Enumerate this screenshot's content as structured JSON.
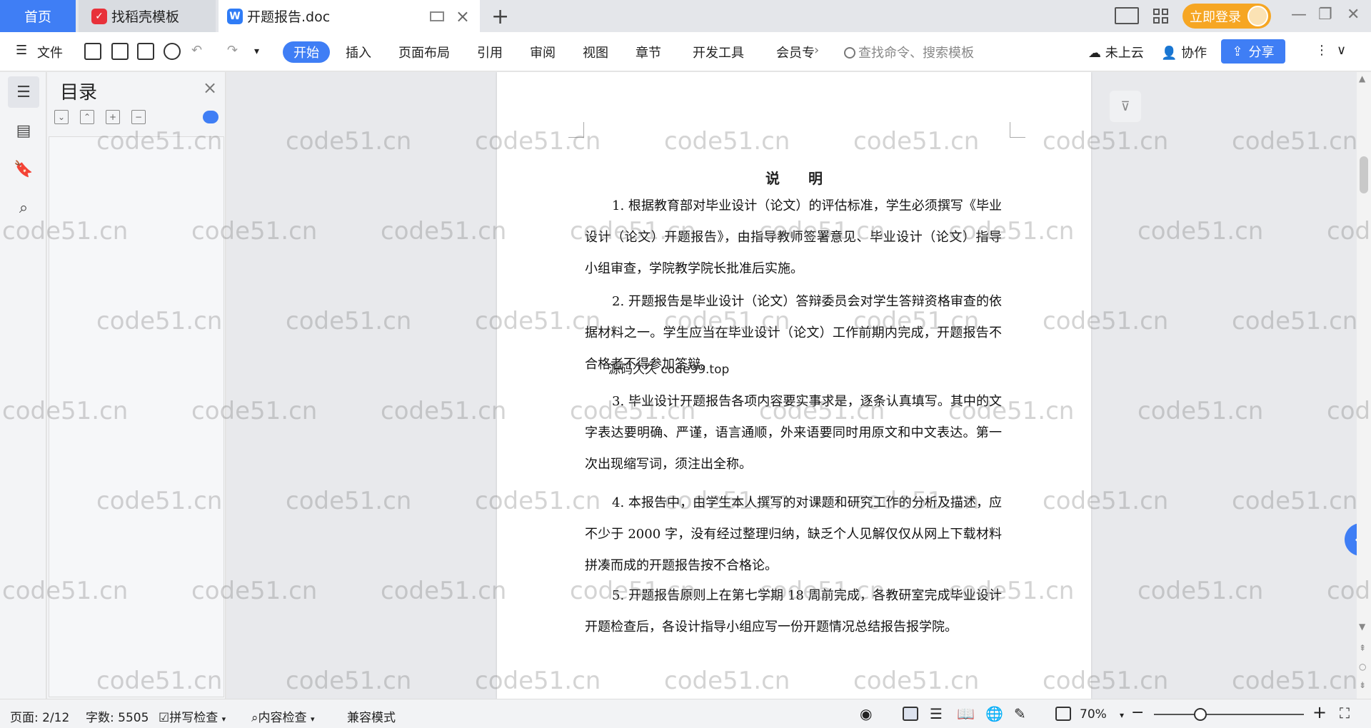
{
  "tabs": {
    "home": "首页",
    "template": "找稻壳模板",
    "document": "开题报告.doc",
    "new_tab": "+"
  },
  "account": {
    "login": "立即登录"
  },
  "toolbar": {
    "file": "文件",
    "menus": [
      "开始",
      "插入",
      "页面布局",
      "引用",
      "审阅",
      "视图",
      "章节",
      "开发工具",
      "会员专"
    ],
    "search_placeholder": "查找命令、搜索模板",
    "cloud": "未上云",
    "collab": "协作",
    "share": "分享"
  },
  "toc": {
    "title": "目录"
  },
  "document": {
    "title": "说明",
    "paragraphs": [
      "1. 根据教育部对毕业设计（论文）的评估标准，学生必须撰写《毕业设计（论文）开题报告》，由指导教师签署意见、毕业设计（论文）指导小组审查，学院教学院长批准后实施。",
      "2. 开题报告是毕业设计（论文）答辩委员会对学生答辩资格审查的依据材料之一。学生应当在毕业设计（论文）工作前期内完成，开题报告不合格者不得参加答辩。",
      "3. 毕业设计开题报告各项内容要实事求是，逐条认真填写。其中的文字表达要明确、严谨，语言通顺，外来语要同时用原文和中文表达。第一次出现缩写词，须注出全称。",
      "4. 本报告中，由学生本人撰写的对课题和研究工作的分析及描述，应不少于 2000 字，没有经过整理归纳，缺乏个人见解仅仅从网上下载材料拼凑而成的开题报告按不合格论。",
      "5. 开题报告原则上在第七学期 18 周前完成，各教研室完成毕业设计开题检查后，各设计指导小组应写一份开题情况总结报告报学院。"
    ],
    "overlay": "源码久久 code99.top"
  },
  "watermark": "code51.cn",
  "status": {
    "page": "页面: 2/12",
    "words": "字数: 5505",
    "spell": "拼写检查",
    "content_check": "内容检查",
    "compat": "兼容模式",
    "zoom": "70%"
  }
}
